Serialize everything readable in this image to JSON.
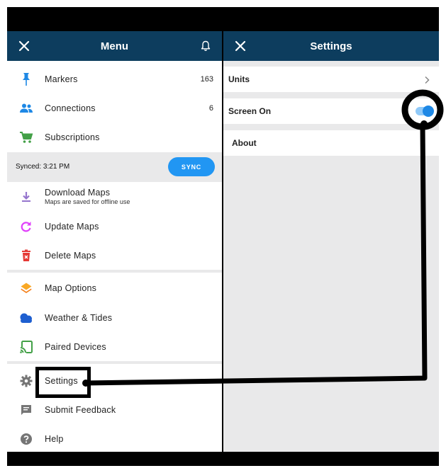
{
  "menu_panel": {
    "title": "Menu",
    "groups": [
      {
        "items": [
          {
            "label": "Markers",
            "count": "163",
            "icon": "pin-icon",
            "color": "#1e88e5"
          },
          {
            "label": "Connections",
            "count": "6",
            "icon": "people-icon",
            "color": "#1e88e5"
          },
          {
            "label": "Subscriptions",
            "count": "",
            "icon": "cart-icon",
            "color": "#43a047"
          }
        ]
      },
      {
        "items": [
          {
            "label": "Download Maps",
            "subtitle": "Maps are saved for offline use",
            "icon": "download-icon",
            "color": "#9575cd"
          },
          {
            "label": "Update Maps",
            "icon": "refresh-icon",
            "color": "#e040fb"
          },
          {
            "label": "Delete Maps",
            "icon": "trash-icon",
            "color": "#e53935"
          }
        ]
      },
      {
        "items": [
          {
            "label": "Map Options",
            "icon": "layers-icon",
            "color": "#f9a825"
          },
          {
            "label": "Weather & Tides",
            "icon": "cloud-icon",
            "color": "#1e5fd0"
          },
          {
            "label": "Paired Devices",
            "icon": "cast-icon",
            "color": "#43a047"
          }
        ]
      },
      {
        "items": [
          {
            "label": "Settings",
            "icon": "gear-icon",
            "color": "#757575"
          },
          {
            "label": "Submit Feedback",
            "icon": "feedback-icon",
            "color": "#757575"
          },
          {
            "label": "Help",
            "icon": "help-icon",
            "color": "#757575"
          }
        ]
      }
    ],
    "sync": {
      "status": "Synced: 3:21 PM",
      "button_label": "SYNC"
    }
  },
  "settings_panel": {
    "title": "Settings",
    "rows": [
      {
        "label": "Units",
        "control": "chevron"
      },
      {
        "label": "Screen On",
        "control": "toggle",
        "value": true
      },
      {
        "label": "About",
        "control": "none"
      }
    ]
  },
  "colors": {
    "navbar": "#0d3d5e",
    "accent": "#2196f3",
    "group_background": "#e9e9ea"
  }
}
